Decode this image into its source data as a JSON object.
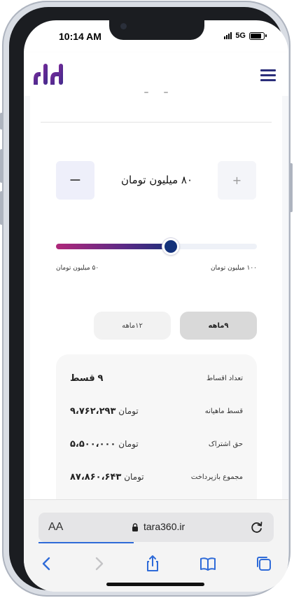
{
  "status_bar": {
    "time": "10:14 AM",
    "network": "5G"
  },
  "header": {
    "logo_icon": "tara-logo-icon",
    "menu_icon": "hamburger-menu-icon"
  },
  "loan": {
    "amount_label": "۸۰ میلیون تومان",
    "minus_label": "−",
    "plus_label": "+",
    "slider": {
      "min_label": "۵۰ میلیون تومان",
      "max_label": "۱۰۰ میلیون تومان",
      "level": 0.57
    },
    "tabs": [
      {
        "label": "۱۲ماهه",
        "selected": false
      },
      {
        "label": "۹ماهه",
        "selected": true
      }
    ],
    "summary": [
      {
        "label": "تعداد اقساط",
        "value_num": "۹",
        "value_unit": "قسط"
      },
      {
        "label": "قسط ماهیانه",
        "value_num": "۹،۷۶۲،۲۹۳",
        "value_unit": "تومان"
      },
      {
        "label": "حق اشتراک",
        "value_num": "۵،۵۰۰،۰۰۰",
        "value_unit": "تومان"
      },
      {
        "label": "مجموع بازپرداخت",
        "value_num": "۸۷،۸۶۰،۶۴۳",
        "value_unit": "تومان"
      }
    ]
  },
  "browser": {
    "aa_label": "AA",
    "url": "tara360.ir"
  },
  "colors": {
    "brand_purple": "#5b2d8e",
    "brand_navy": "#2b2e7a",
    "slider_start": "#b0287a",
    "slider_end": "#1f2f7a",
    "safari_blue": "#2f6bd8"
  }
}
